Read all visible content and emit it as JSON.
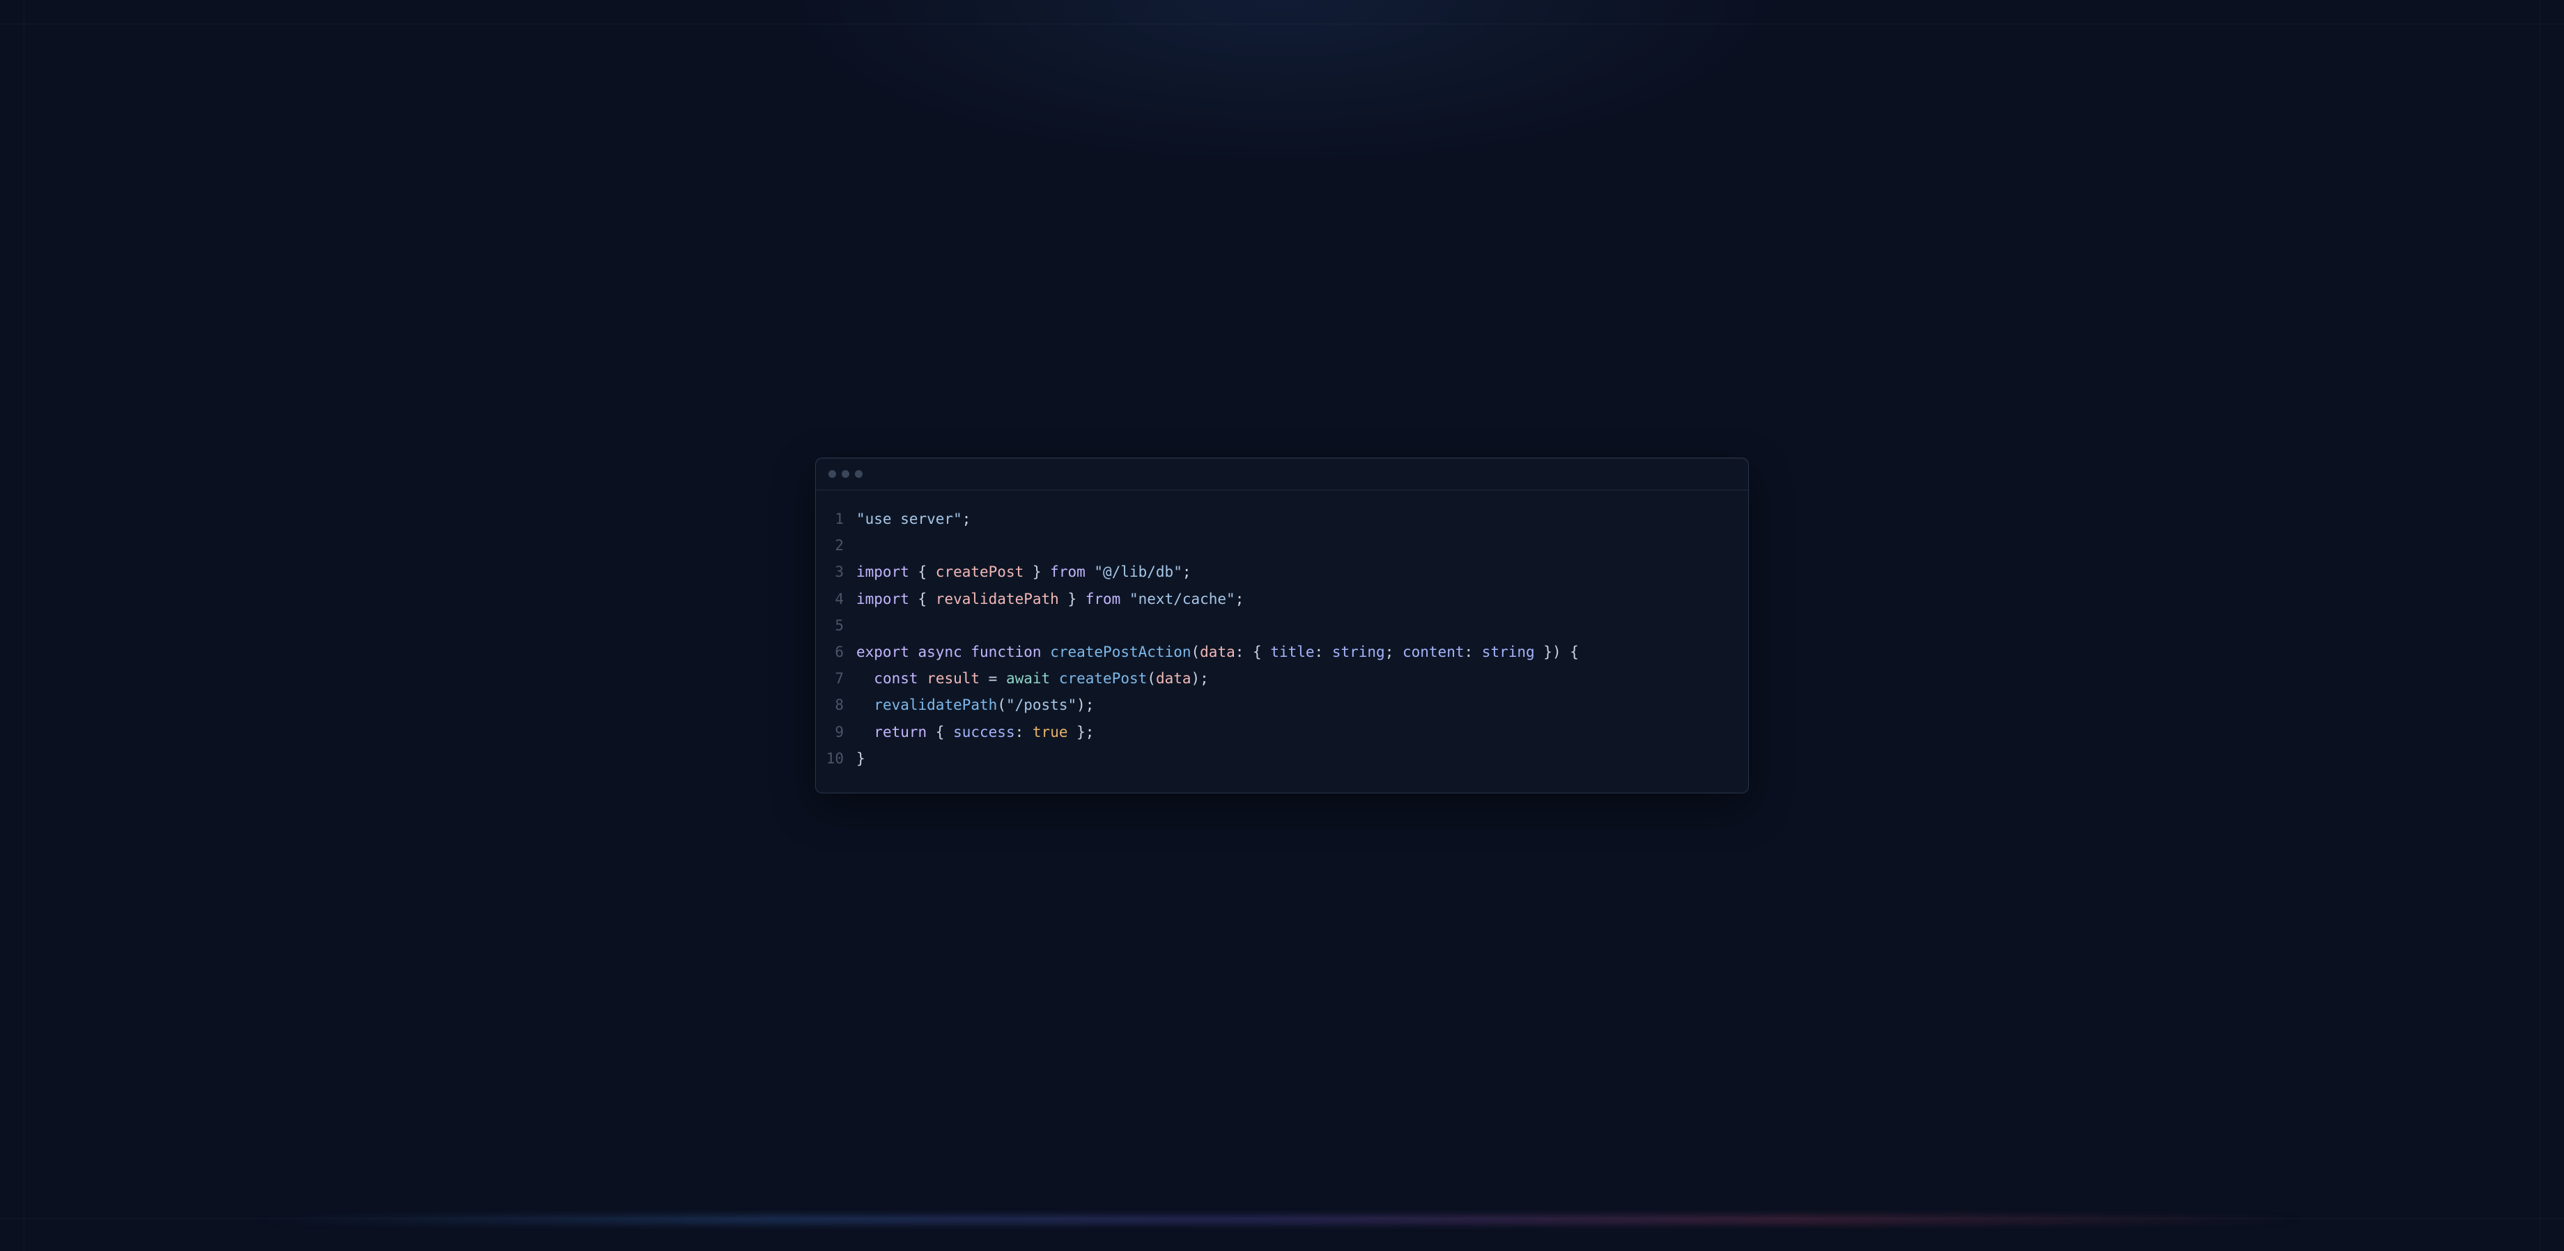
{
  "window": {
    "traffic_light_count": 3
  },
  "code": {
    "lines": [
      {
        "n": "1",
        "tokens": [
          {
            "t": "\"use server\"",
            "c": "tk-str"
          },
          {
            "t": ";",
            "c": "tk-punc"
          }
        ]
      },
      {
        "n": "2",
        "tokens": [
          {
            "t": "",
            "c": "tk-plain"
          }
        ]
      },
      {
        "n": "3",
        "tokens": [
          {
            "t": "import",
            "c": "tk-kw"
          },
          {
            "t": " { ",
            "c": "tk-punc"
          },
          {
            "t": "createPost",
            "c": "tk-id"
          },
          {
            "t": " } ",
            "c": "tk-punc"
          },
          {
            "t": "from",
            "c": "tk-kw"
          },
          {
            "t": " ",
            "c": "tk-plain"
          },
          {
            "t": "\"@/lib/db\"",
            "c": "tk-str"
          },
          {
            "t": ";",
            "c": "tk-punc"
          }
        ]
      },
      {
        "n": "4",
        "tokens": [
          {
            "t": "import",
            "c": "tk-kw"
          },
          {
            "t": " { ",
            "c": "tk-punc"
          },
          {
            "t": "revalidatePath",
            "c": "tk-id"
          },
          {
            "t": " } ",
            "c": "tk-punc"
          },
          {
            "t": "from",
            "c": "tk-kw"
          },
          {
            "t": " ",
            "c": "tk-plain"
          },
          {
            "t": "\"next/cache\"",
            "c": "tk-str"
          },
          {
            "t": ";",
            "c": "tk-punc"
          }
        ]
      },
      {
        "n": "5",
        "tokens": [
          {
            "t": "",
            "c": "tk-plain"
          }
        ]
      },
      {
        "n": "6",
        "tokens": [
          {
            "t": "export",
            "c": "tk-kw"
          },
          {
            "t": " ",
            "c": "tk-plain"
          },
          {
            "t": "async",
            "c": "tk-kw"
          },
          {
            "t": " ",
            "c": "tk-plain"
          },
          {
            "t": "function",
            "c": "tk-kw"
          },
          {
            "t": " ",
            "c": "tk-plain"
          },
          {
            "t": "createPostAction",
            "c": "tk-fn"
          },
          {
            "t": "(",
            "c": "tk-punc"
          },
          {
            "t": "data",
            "c": "tk-id"
          },
          {
            "t": ": { ",
            "c": "tk-punc"
          },
          {
            "t": "title",
            "c": "tk-type"
          },
          {
            "t": ": ",
            "c": "tk-punc"
          },
          {
            "t": "string",
            "c": "tk-type"
          },
          {
            "t": "; ",
            "c": "tk-punc"
          },
          {
            "t": "content",
            "c": "tk-type"
          },
          {
            "t": ": ",
            "c": "tk-punc"
          },
          {
            "t": "string",
            "c": "tk-type"
          },
          {
            "t": " }) {",
            "c": "tk-punc"
          }
        ]
      },
      {
        "n": "7",
        "tokens": [
          {
            "t": "  ",
            "c": "tk-plain"
          },
          {
            "t": "const",
            "c": "tk-kw"
          },
          {
            "t": " ",
            "c": "tk-plain"
          },
          {
            "t": "result",
            "c": "tk-id"
          },
          {
            "t": " = ",
            "c": "tk-punc"
          },
          {
            "t": "await",
            "c": "tk-await"
          },
          {
            "t": " ",
            "c": "tk-plain"
          },
          {
            "t": "createPost",
            "c": "tk-fn"
          },
          {
            "t": "(",
            "c": "tk-punc"
          },
          {
            "t": "data",
            "c": "tk-id"
          },
          {
            "t": ");",
            "c": "tk-punc"
          }
        ]
      },
      {
        "n": "8",
        "tokens": [
          {
            "t": "  ",
            "c": "tk-plain"
          },
          {
            "t": "revalidatePath",
            "c": "tk-fn"
          },
          {
            "t": "(",
            "c": "tk-punc"
          },
          {
            "t": "\"/posts\"",
            "c": "tk-str"
          },
          {
            "t": ");",
            "c": "tk-punc"
          }
        ]
      },
      {
        "n": "9",
        "tokens": [
          {
            "t": "  ",
            "c": "tk-plain"
          },
          {
            "t": "return",
            "c": "tk-kw"
          },
          {
            "t": " { ",
            "c": "tk-punc"
          },
          {
            "t": "success",
            "c": "tk-type"
          },
          {
            "t": ": ",
            "c": "tk-punc"
          },
          {
            "t": "true",
            "c": "tk-bool"
          },
          {
            "t": " };",
            "c": "tk-punc"
          }
        ]
      },
      {
        "n": "10",
        "tokens": [
          {
            "t": "}",
            "c": "tk-punc"
          }
        ]
      }
    ]
  }
}
